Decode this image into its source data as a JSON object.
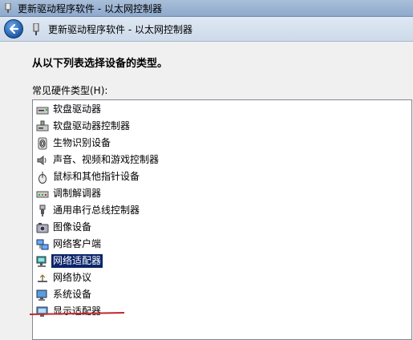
{
  "window": {
    "title": "更新驱动程序软件 - 以太网控制器"
  },
  "nav": {
    "title": "更新驱动程序软件 - 以太网控制器"
  },
  "content": {
    "instruction": "从以下列表选择设备的类型。",
    "list_label": "常见硬件类型(H):"
  },
  "hardware_list": {
    "items": [
      {
        "label": "软盘驱动器",
        "icon": "floppy-drive-icon"
      },
      {
        "label": "软盘驱动器控制器",
        "icon": "floppy-controller-icon"
      },
      {
        "label": "生物识别设备",
        "icon": "biometric-icon"
      },
      {
        "label": "声音、视频和游戏控制器",
        "icon": "speaker-icon"
      },
      {
        "label": "鼠标和其他指针设备",
        "icon": "mouse-icon"
      },
      {
        "label": "调制解调器",
        "icon": "modem-icon"
      },
      {
        "label": "通用串行总线控制器",
        "icon": "usb-icon"
      },
      {
        "label": "图像设备",
        "icon": "camera-icon"
      },
      {
        "label": "网络客户端",
        "icon": "network-client-icon"
      },
      {
        "label": "网络适配器",
        "icon": "network-adapter-icon"
      },
      {
        "label": "网络协议",
        "icon": "network-protocol-icon"
      },
      {
        "label": "系统设备",
        "icon": "system-device-icon"
      },
      {
        "label": "显示适配器",
        "icon": "display-adapter-icon"
      }
    ],
    "selected_index": 9
  },
  "colors": {
    "selection": "#0a246a",
    "annotation": "#c0282d"
  }
}
